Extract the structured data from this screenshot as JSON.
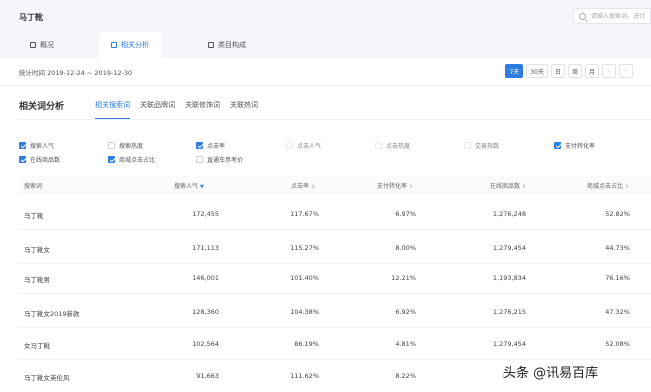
{
  "header": {
    "title": "马丁靴",
    "search_placeholder": "请输入搜索词，进行"
  },
  "tabs": [
    {
      "label": "概况",
      "icon": "overview-icon"
    },
    {
      "label": "相关分析",
      "icon": "analysis-icon"
    },
    {
      "label": "类目构成",
      "icon": "category-icon"
    }
  ],
  "stats": {
    "range_text": "统计时间 2019-12-24 ~ 2019-12-30",
    "periods": [
      "7天",
      "30天",
      "日",
      "周",
      "月"
    ],
    "active_period": "7天"
  },
  "section": {
    "title": "相关词分析",
    "subtabs": [
      "相关搜索词",
      "关联品牌词",
      "关联修饰词",
      "关联热词"
    ]
  },
  "metrics": [
    {
      "label": "搜索人气",
      "checked": true
    },
    {
      "label": "搜索热度",
      "checked": false
    },
    {
      "label": "点击率",
      "checked": true
    },
    {
      "label": "点击人气",
      "checked": false
    },
    {
      "label": "点击热度",
      "checked": false
    },
    {
      "label": "交易指数",
      "checked": false
    },
    {
      "label": "支付转化率",
      "checked": true
    },
    {
      "label": "在线商品数",
      "checked": true
    },
    {
      "label": "商城点击占比",
      "checked": true
    },
    {
      "label": "直通车参考价",
      "checked": false
    }
  ],
  "table": {
    "columns": [
      "搜索词",
      "搜索人气",
      "点击率",
      "支付转化率",
      "在线商品数",
      "商城点击占比"
    ],
    "rows": [
      [
        "马丁靴",
        "172,455",
        "117.67%",
        "6.97%",
        "1,276,248",
        "52.82%"
      ],
      [
        "马丁靴女",
        "171,113",
        "115.27%",
        "8.00%",
        "1,279,454",
        "44.73%"
      ],
      [
        "马丁靴男",
        "146,001",
        "101.40%",
        "12.21%",
        "1,193,834",
        "76.16%"
      ],
      [
        "马丁靴女2019新款",
        "128,360",
        "104.38%",
        "6.92%",
        "1,276,215",
        "47.32%"
      ],
      [
        "女马丁靴",
        "102,564",
        "86.19%",
        "4.81%",
        "1,279,454",
        "52.08%"
      ],
      [
        "马丁靴女英伦风",
        "91,663",
        "111.62%",
        "8.22%",
        "1,067,1",
        ""
      ]
    ]
  },
  "watermark": "头条 @讯易百库",
  "colors": {
    "accent": "#2d7de3",
    "topbar": "#f4f6fa"
  }
}
